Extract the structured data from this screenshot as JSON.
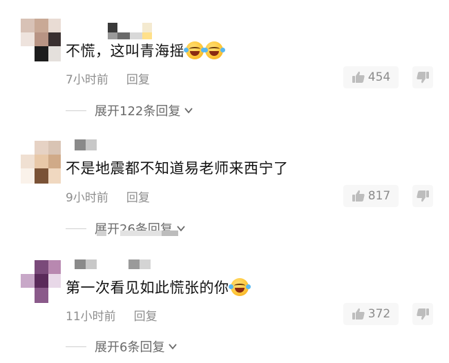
{
  "comments": [
    {
      "text": "不慌，这叫青海摇",
      "emoji_count": 2,
      "time": "7小时前",
      "reply": "回复",
      "likes": "454",
      "expand": "展开122条回复"
    },
    {
      "text": "不是地震都不知道易老师来西宁了",
      "emoji_count": 0,
      "time": "9小时前",
      "reply": "回复",
      "likes": "817",
      "expand": "展开26条回复"
    },
    {
      "text": "第一次看见如此慌张的你",
      "emoji_count": 1,
      "time": "11小时前",
      "reply": "回复",
      "likes": "372",
      "expand": "展开6条回复"
    }
  ],
  "icons": {
    "like": "thumbs-up-icon",
    "dislike": "thumbs-down-icon",
    "emoji": "laughing-crying-emoji-icon",
    "expand": "chevron-down-icon"
  },
  "colors": {
    "meta_text": "#8e8e8e",
    "like_bg": "#f7f7f7"
  }
}
